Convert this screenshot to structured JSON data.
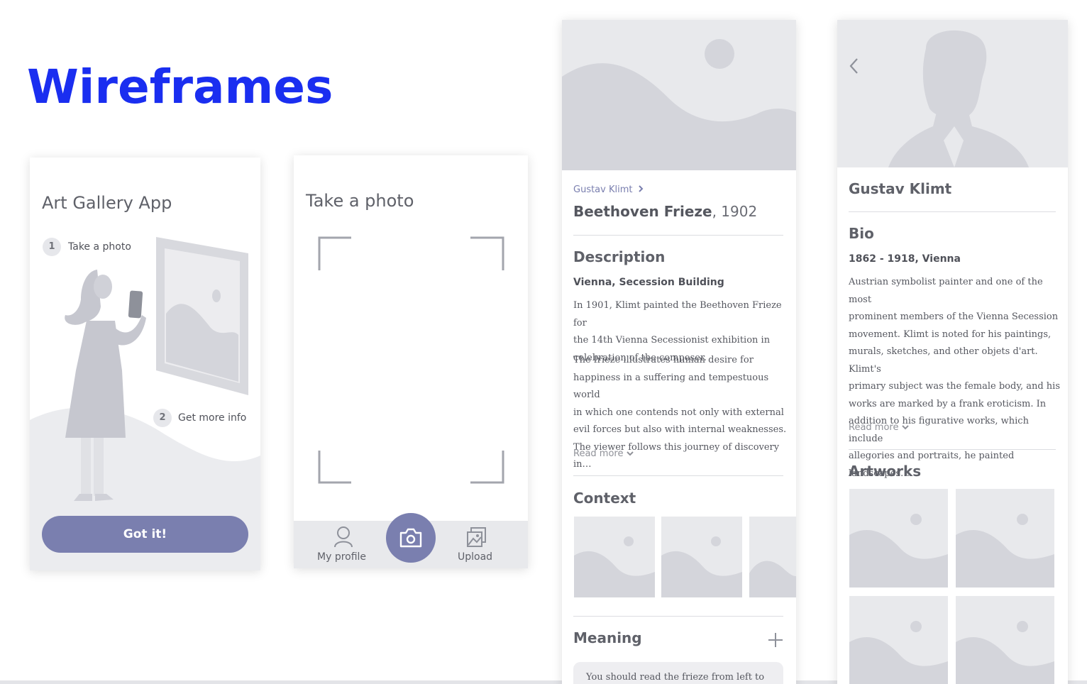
{
  "page": {
    "title": "Wireframes"
  },
  "onboarding": {
    "title": "Art Gallery App",
    "steps": [
      {
        "number": "1",
        "label": "Take a photo"
      },
      {
        "number": "2",
        "label": "Get more info"
      }
    ],
    "button_label": "Got it!"
  },
  "camera": {
    "title": "Take a photo",
    "tabs": {
      "profile_label": "My profile",
      "upload_label": "Upload"
    },
    "icons": {
      "profile": "user-icon",
      "capture": "camera-icon",
      "upload": "image-upload-icon"
    }
  },
  "artwork": {
    "artist_link": "Gustav Klimt",
    "title": "Beethoven Frieze",
    "year": ", 1902",
    "description_heading": "Description",
    "location": "Vienna, Secession Building",
    "paragraph_1_lines": [
      "In 1901, Klimt painted the Beethoven Frieze for",
      "the 14th Vienna Secessionist exhibition in",
      "celebration of the composer."
    ],
    "paragraph_2_lines": [
      "The frieze illustrates human desire for",
      "happiness in a suffering and tempestuous world",
      "in which one contends not only with external",
      "evil forces but also with internal weaknesses.",
      "The viewer follows this journey of discovery in…"
    ],
    "read_more": "Read more",
    "context_heading": "Context",
    "meaning_heading": "Meaning",
    "meaning_quote": "You should read the frieze from left to"
  },
  "artist": {
    "name": "Gustav Klimt",
    "bio_heading": "Bio",
    "dates": "1862 - 1918, Vienna",
    "bio_lines": [
      "Austrian symbolist painter and one of the most",
      "prominent members of the Vienna Secession",
      "movement. Klimt is noted for his paintings,",
      "murals, sketches, and other objets d'art. Klimt's",
      "primary subject was the female body, and his",
      "works are marked by a frank eroticism. In",
      "addition to his figurative works, which include",
      "allegories and portraits, he painted landscapes…"
    ],
    "read_more": "Read more",
    "artworks_heading": "Artworks"
  },
  "colors": {
    "title_blue": "#1a2ef0",
    "accent": "#7a7faf",
    "placeholder": "#e8e9ec",
    "placeholder_shape": "#d4d5db"
  }
}
